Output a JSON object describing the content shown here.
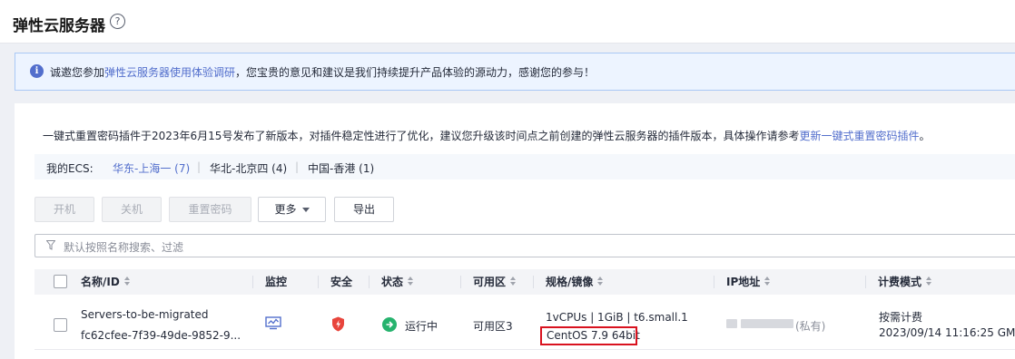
{
  "header": {
    "title": "弹性云服务器",
    "help_glyph": "?"
  },
  "banner": {
    "prefix": "诚邀您参加",
    "link": "弹性云服务器使用体验调研",
    "suffix": "，您宝贵的意见和建议是我们持续提升产品体验的源动力，感谢您的参与！"
  },
  "notice": {
    "text": "一键式重置密码插件于2023年6月15号发布了新版本，对插件稳定性进行了优化，建议您升级该时间点之前创建的弹性云服务器的插件版本，具体操作请参考",
    "link": "更新一键式重置密码插件",
    "end": "。"
  },
  "regions": {
    "label": "我的ECS:",
    "items": [
      {
        "label": "华东-上海一 (7)"
      },
      {
        "label": "华北-北京四 (4)"
      },
      {
        "label": "中国-香港 (1)"
      }
    ],
    "separator": "|"
  },
  "toolbar": {
    "start": "开机",
    "stop": "关机",
    "reset": "重置密码",
    "more": "更多",
    "export": "导出"
  },
  "search": {
    "placeholder": "默认按照名称搜索、过滤"
  },
  "table": {
    "headers": {
      "name": "名称/ID",
      "monitor": "监控",
      "security": "安全",
      "status": "状态",
      "az": "可用区",
      "spec": "规格/镜像",
      "ip": "IP地址",
      "billing": "计费模式"
    },
    "rows": [
      {
        "name": "Servers-to-be-migrated",
        "id": "fc62cfee-7f39-49de-9852-9...",
        "status": "运行中",
        "az": "可用区3",
        "spec": "1vCPUs | 1GiB | t6.small.1",
        "image": "CentOS 7.9 64bit",
        "ip_type": "(私有)",
        "billing": "按需计费",
        "created": "2023/09/14 11:16:25 GM..."
      }
    ]
  },
  "colors": {
    "accent": "#526ecc",
    "running": "#26b36e",
    "security": "#e8453c",
    "highlight": "#d9121f"
  }
}
